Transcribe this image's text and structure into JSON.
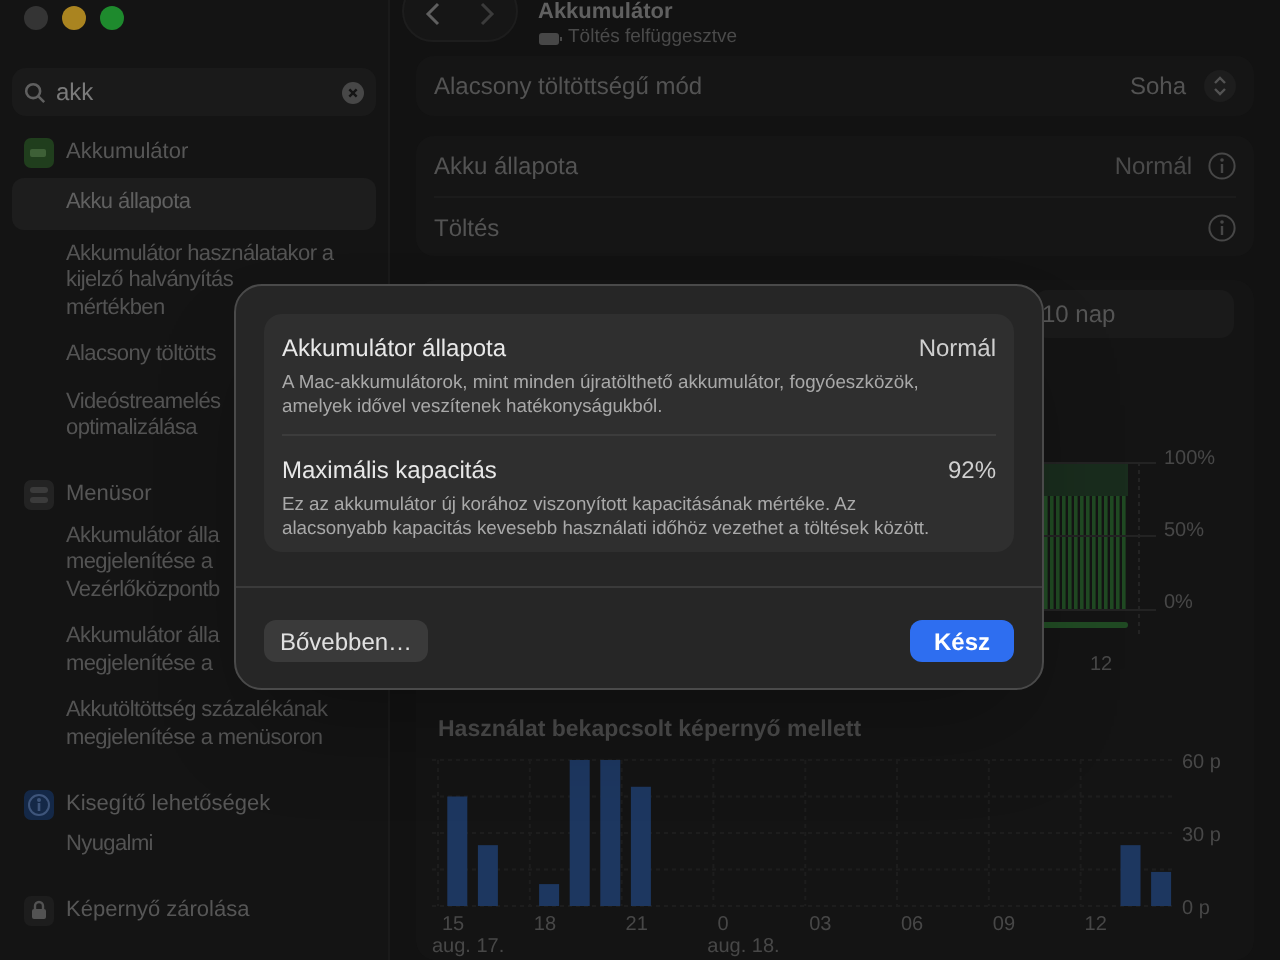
{
  "sidebar": {
    "search": {
      "value": "akk"
    },
    "sections": [
      {
        "title": "Akkumulátor",
        "kind": "battery",
        "items": [
          {
            "text": "Akku állapota",
            "selected": true
          },
          {
            "text": "Akkumulátor használatakor a\nkijelző halványítás\nmértékben",
            "selected": false
          },
          {
            "text": "Alacsony töltötts",
            "selected": false
          },
          {
            "text": "Videóstreamelés\noptimalizálása",
            "selected": false
          }
        ]
      },
      {
        "title": "Menüsor",
        "kind": "menubar",
        "items": [
          {
            "text": "Akkumulátor álla\nmegjelenítése a\nVezérlőközpontb",
            "selected": false
          },
          {
            "text": "Akkumulátor álla\nmegjelenítése a",
            "selected": false
          },
          {
            "text": "Akkutöltöttség százalékának\nmegjelenítése a menüsoron",
            "selected": false
          }
        ]
      },
      {
        "title": "Kisegítő lehetőségek",
        "kind": "accessibility",
        "items": [
          {
            "text": "Nyugalmi",
            "selected": false
          }
        ]
      },
      {
        "title": "Képernyő zárolása",
        "kind": "lock"
      }
    ]
  },
  "header": {
    "title": "Akkumulátor",
    "subtitle": "Töltés felfüggesztve"
  },
  "settings": [
    {
      "rows": [
        {
          "label": "Alacsony töltöttségű mód",
          "value": "Soha",
          "kind": "popup"
        }
      ]
    },
    {
      "rows": [
        {
          "label": "Akku állapota",
          "value": "Normál",
          "kind": "info"
        },
        {
          "label": "Töltés",
          "kind": "info"
        }
      ]
    }
  ],
  "usage": {
    "range": "10 nap",
    "level_chart": {
      "y_labels": [
        "100%",
        "50%",
        "0%"
      ],
      "x_labels": [
        "12"
      ]
    },
    "screen_on": {
      "chart_data": {
        "type": "bar",
        "title": "Használat bekapcsolt képernyő mellett",
        "categories": [
          "15",
          null,
          null,
          "18",
          null,
          null,
          "21",
          null,
          null,
          "0",
          null,
          null,
          "03",
          null,
          null,
          "06",
          null,
          null,
          "09",
          null,
          null,
          "12",
          null,
          null
        ],
        "values": [
          45,
          25,
          0,
          9,
          60,
          60,
          49,
          0,
          0,
          0,
          0,
          0,
          0,
          0,
          0,
          0,
          0,
          0,
          0,
          0,
          0,
          0,
          25,
          14
        ],
        "ylim": [
          0,
          60
        ],
        "yticks": [
          {
            "value": 60,
            "label": "60 p"
          },
          {
            "value": 30,
            "label": "30 p"
          },
          {
            "value": 0,
            "label": "0 p"
          }
        ]
      },
      "dates": [
        "aug. 17.",
        "aug. 18."
      ]
    }
  },
  "dialog": {
    "rows": [
      {
        "title": "Akkumulátor állapota",
        "value": "Normál",
        "description": "A Mac-akkumulátorok, mint minden újratölthető akkumulátor, fogyóeszközök, amelyek idővel veszítenek hatékonyságukból."
      },
      {
        "title": "Maximális kapacitás",
        "value": "92%",
        "description": "Ez az akkumulátor új korához viszonyított kapacitásának mértéke. Az alacsonyabb kapacitás kevesebb használati időhöz vezethet a töltések között."
      }
    ],
    "buttons": [
      {
        "label": "Bővebben…",
        "kind": "secondary"
      },
      {
        "label": "Kész",
        "kind": "primary"
      }
    ]
  }
}
